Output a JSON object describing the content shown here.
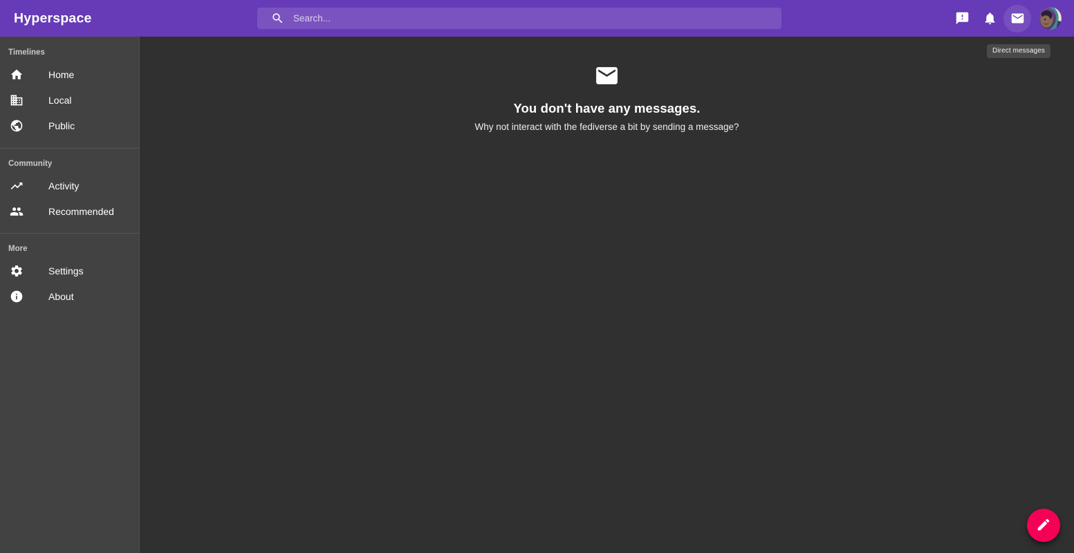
{
  "app": {
    "brand": "Hyperspace"
  },
  "search": {
    "placeholder": "Search...",
    "value": "",
    "icon": "search-icon"
  },
  "appbar": {
    "actions": [
      {
        "name": "announcements-button",
        "icon": "announcement-icon",
        "label": "Announcements"
      },
      {
        "name": "notifications-button",
        "icon": "bell-icon",
        "label": "Notifications"
      },
      {
        "name": "direct-messages-button",
        "icon": "mail-icon",
        "label": "Direct messages"
      }
    ],
    "avatar": {
      "name": "account-avatar",
      "label": "Account"
    }
  },
  "tooltip": {
    "text": "Direct messages"
  },
  "sidebar": {
    "sections": [
      {
        "label": "Timelines",
        "items": [
          {
            "label": "Home",
            "icon": "home-icon"
          },
          {
            "label": "Local",
            "icon": "domain-icon"
          },
          {
            "label": "Public",
            "icon": "public-globe-icon"
          }
        ]
      },
      {
        "label": "Community",
        "items": [
          {
            "label": "Activity",
            "icon": "trending-up-icon"
          },
          {
            "label": "Recommended",
            "icon": "people-icon"
          }
        ]
      },
      {
        "label": "More",
        "items": [
          {
            "label": "Settings",
            "icon": "gear-icon"
          },
          {
            "label": "About",
            "icon": "info-icon"
          }
        ]
      }
    ]
  },
  "main": {
    "empty_state": {
      "icon": "mail-envelope-icon",
      "title": "You don't have any messages.",
      "subtitle": "Why not interact with the fediverse a bit by sending a message?"
    }
  },
  "fab": {
    "name": "compose-button",
    "icon": "pencil-icon",
    "label": "Compose",
    "color": "#F50057"
  },
  "colors": {
    "appbar": "#673AB7",
    "sidebar": "#424242",
    "content": "#303030",
    "accent": "#F50057",
    "text": "#FFFFFF"
  }
}
